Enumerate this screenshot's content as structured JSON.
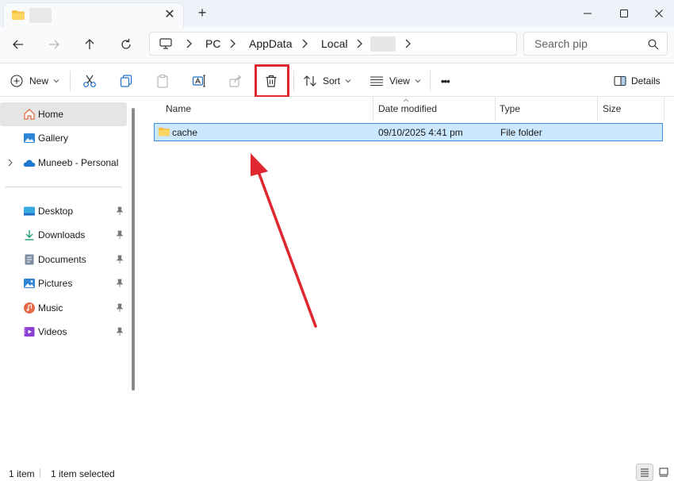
{
  "tab": {
    "close": "✕"
  },
  "newtab": "+",
  "address": {
    "crumbs": [
      "PC",
      "AppData",
      "Local"
    ]
  },
  "search": {
    "placeholder": "Search pip"
  },
  "command_bar": {
    "new_label": "New",
    "sort_label": "Sort",
    "view_label": "View",
    "details_label": "Details",
    "more": "•••"
  },
  "sidebar": {
    "pinned_top": [
      {
        "label": "Home",
        "icon": "home-icon"
      },
      {
        "label": "Gallery",
        "icon": "gallery-icon"
      },
      {
        "label": "Muneeb - Personal",
        "icon": "onedrive-icon"
      }
    ],
    "quick_access": [
      {
        "label": "Desktop",
        "icon": "desktop-icon"
      },
      {
        "label": "Downloads",
        "icon": "downloads-icon"
      },
      {
        "label": "Documents",
        "icon": "documents-icon"
      },
      {
        "label": "Pictures",
        "icon": "pictures-icon"
      },
      {
        "label": "Music",
        "icon": "music-icon"
      },
      {
        "label": "Videos",
        "icon": "videos-icon"
      }
    ]
  },
  "columns": {
    "name": "Name",
    "date": "Date modified",
    "type": "Type",
    "size": "Size"
  },
  "files": [
    {
      "name": "cache",
      "date": "09/10/2025 4:41 pm",
      "type": "File folder",
      "size": ""
    }
  ],
  "status": {
    "count": "1 item",
    "selected": "1 item selected"
  },
  "colors": {
    "highlight": "#e0262f",
    "selection_bg": "#cce8ff",
    "selection_border": "#3d8ee0",
    "folder": "#f5c042"
  }
}
